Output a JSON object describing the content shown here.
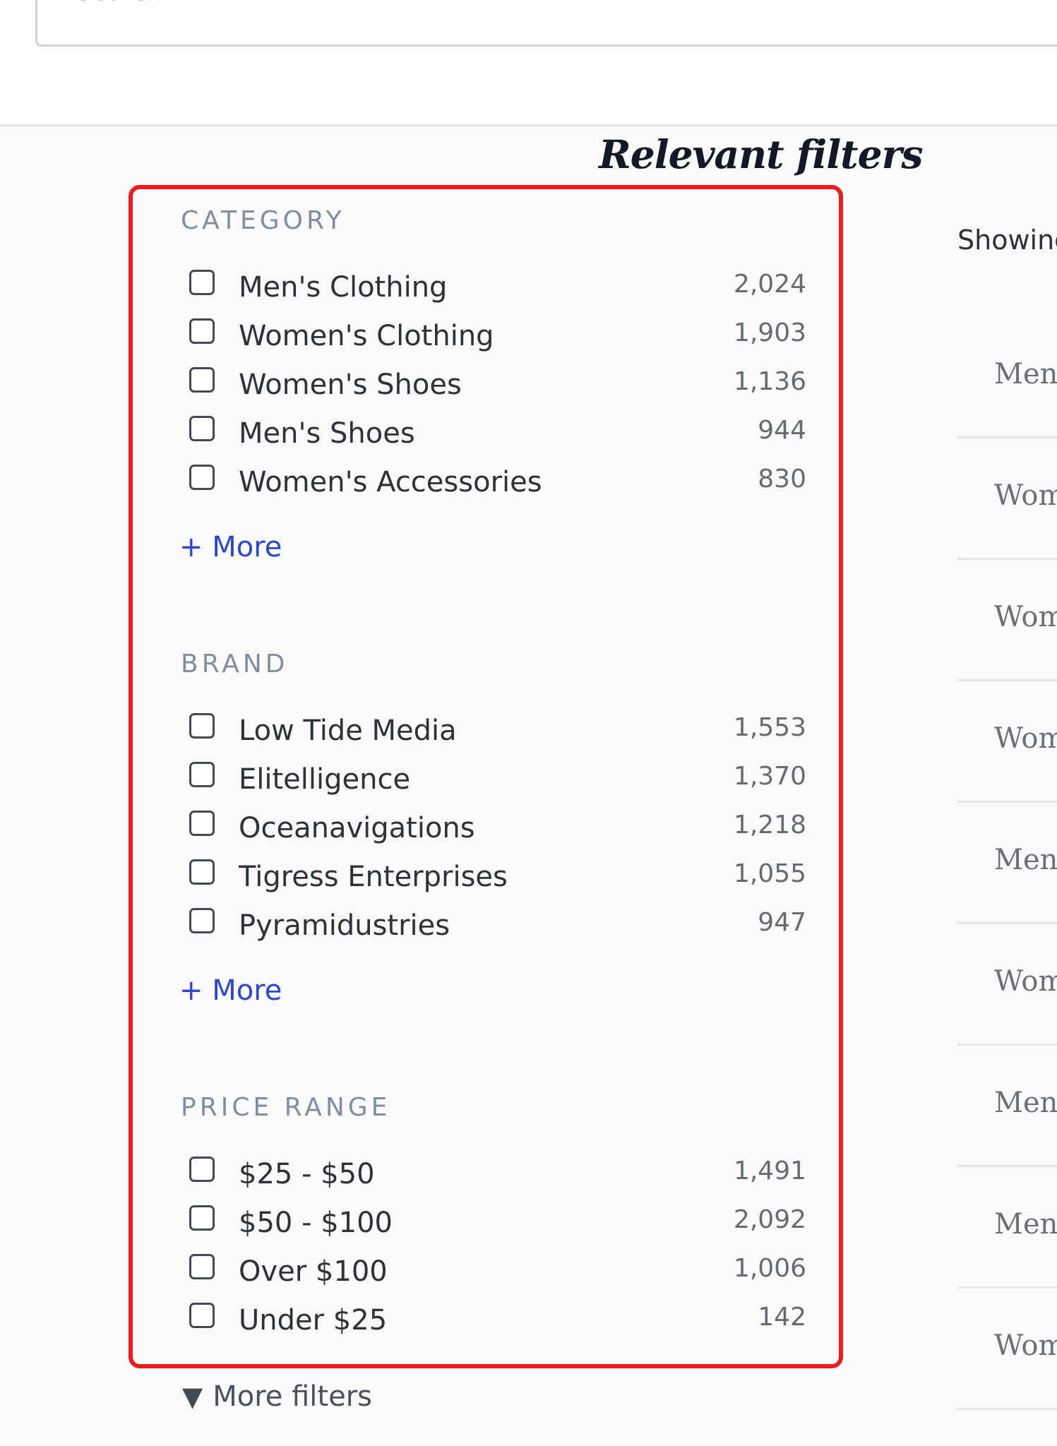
{
  "search": {
    "placeholder": "Search"
  },
  "annotation": {
    "title": "Relevant filters"
  },
  "filters": {
    "category": {
      "title": "CATEGORY",
      "items": [
        {
          "label": "Men's Clothing",
          "count": "2,024"
        },
        {
          "label": "Women's Clothing",
          "count": "1,903"
        },
        {
          "label": "Women's Shoes",
          "count": "1,136"
        },
        {
          "label": "Men's Shoes",
          "count": "944"
        },
        {
          "label": "Women's Accessories",
          "count": "830"
        }
      ],
      "more_label": "+ More"
    },
    "brand": {
      "title": "BRAND",
      "items": [
        {
          "label": "Low Tide Media",
          "count": "1,553"
        },
        {
          "label": "Elitelligence",
          "count": "1,370"
        },
        {
          "label": "Oceanavigations",
          "count": "1,218"
        },
        {
          "label": "Tigress Enterprises",
          "count": "1,055"
        },
        {
          "label": "Pyramidustries",
          "count": "947"
        }
      ],
      "more_label": "+ More"
    },
    "price": {
      "title": "PRICE RANGE",
      "items": [
        {
          "label": "$25 - $50",
          "count": "1,491"
        },
        {
          "label": "$50 - $100",
          "count": "2,092"
        },
        {
          "label": "Over $100",
          "count": "1,006"
        },
        {
          "label": "Under $25",
          "count": "142"
        }
      ]
    },
    "more_filters_icon": "triangle-down-icon",
    "more_filters_label": "More filters"
  },
  "results": {
    "showing_label": "Showing",
    "items": [
      "Men'",
      "Wom",
      "Wom",
      "Wom",
      "Men'",
      "Wom",
      "Men'",
      "Men'",
      "Wom"
    ]
  },
  "colors": {
    "annotation_border": "#ee1c1c",
    "link": "#2d46d6",
    "section_title": "#7f8ea3"
  }
}
